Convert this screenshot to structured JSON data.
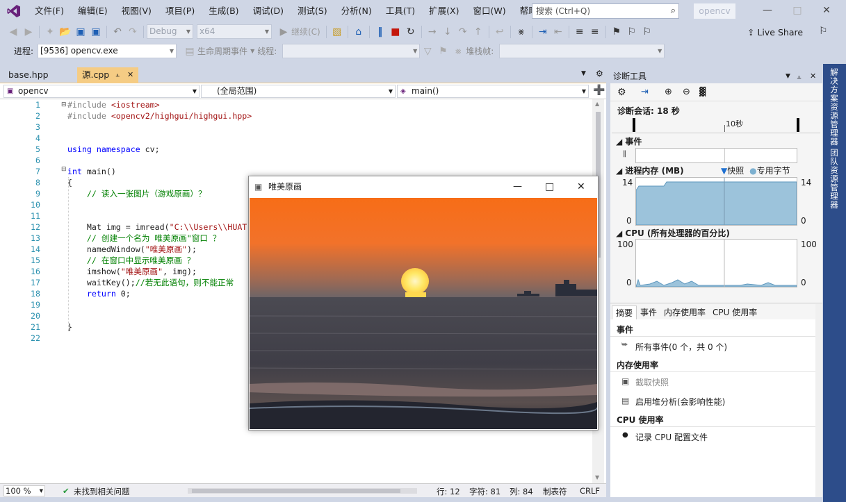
{
  "menu": [
    "文件(F)",
    "编辑(E)",
    "视图(V)",
    "项目(P)",
    "生成(B)",
    "调试(D)",
    "测试(S)",
    "分析(N)",
    "工具(T)",
    "扩展(X)",
    "窗口(W)",
    "帮助(H)"
  ],
  "search_placeholder": "搜索 (Ctrl+Q)",
  "solution_name": "opencv",
  "toolbar": {
    "config": "Debug",
    "platform": "x64",
    "continue_label": "继续(C)",
    "live_share": "Live Share"
  },
  "toolbar2": {
    "process_label": "进程:",
    "process_value": "[9536] opencv.exe",
    "lifecycle_label": "生命周期事件",
    "thread_label": "线程:",
    "stackframe_label": "堆栈帧:"
  },
  "tabs": [
    {
      "label": "base.hpp",
      "active": false
    },
    {
      "label": "源.cpp",
      "active": true
    }
  ],
  "editor_nav": {
    "project": "opencv",
    "scope": "(全局范围)",
    "member": "main()"
  },
  "code_lines": [
    {
      "n": "1",
      "html": "<span class='pp'>#include</span> <span class='inc'>&lt;iostream&gt;</span>"
    },
    {
      "n": "2",
      "html": "<span class='pp'>#include</span> <span class='inc'>&lt;opencv2/highgui/highgui.hpp&gt;</span>"
    },
    {
      "n": "3",
      "html": ""
    },
    {
      "n": "4",
      "html": ""
    },
    {
      "n": "5",
      "html": "<span class='kw'>using namespace</span> cv;"
    },
    {
      "n": "6",
      "html": ""
    },
    {
      "n": "7",
      "html": "<span class='kw'>int</span> main()"
    },
    {
      "n": "8",
      "html": "{"
    },
    {
      "n": "9",
      "html": "    <span class='cm'>// 读入一张图片（游戏原画）？</span>"
    },
    {
      "n": "10",
      "html": ""
    },
    {
      "n": "11",
      "html": ""
    },
    {
      "n": "12",
      "html": "    Mat img = imread(<span class='str'>\"C:\\\\Users\\\\HUAT</span>"
    },
    {
      "n": "13",
      "html": "    <span class='cm'>// 创建一个名为 唯美原画\"窗口 ？</span>"
    },
    {
      "n": "14",
      "html": "    namedWindow(<span class='str'>\"唯美原画\"</span>);"
    },
    {
      "n": "15",
      "html": "    <span class='cm'>// 在窗口中显示唯美原画 ？</span>"
    },
    {
      "n": "16",
      "html": "    imshow(<span class='str'>\"唯美原画\"</span>, img);"
    },
    {
      "n": "17",
      "html": "    waitKey();<span class='cm'>//若无此语句，则不能正常</span>"
    },
    {
      "n": "18",
      "html": "    <span class='kw'>return</span> 0;"
    },
    {
      "n": "19",
      "html": ""
    },
    {
      "n": "20",
      "html": ""
    },
    {
      "n": "21",
      "html": "}"
    },
    {
      "n": "22",
      "html": ""
    }
  ],
  "status": {
    "zoom": "100 %",
    "issues": "未找到相关问题",
    "line": "行: 12",
    "char": "字符: 81",
    "col": "列: 84",
    "tabs": "制表符",
    "eol": "CRLF"
  },
  "image_window": {
    "title": "唯美原画"
  },
  "diagnostics": {
    "title": "诊断工具",
    "session": "诊断会话: 18 秒",
    "timeline_label": "10秒",
    "events_title": "事件",
    "memory_title": "进程内存 (MB)",
    "legend_snapshot": "快照",
    "legend_private": "专用字节",
    "mem_max": "14",
    "mem_min": "0",
    "cpu_title": "CPU (所有处理器的百分比)",
    "cpu_max": "100",
    "cpu_min": "0",
    "subtabs": [
      "摘要",
      "事件",
      "内存使用率",
      "CPU 使用率"
    ],
    "sum_events_header": "事件",
    "all_events": "所有事件(0 个，共 0 个)",
    "mem_header": "内存使用率",
    "take_snapshot": "截取快照",
    "heap_profiling": "启用堆分析(会影响性能)",
    "cpu_header": "CPU 使用率",
    "record_cpu": "记录 CPU 配置文件"
  },
  "right_sidebar": [
    "解决方案资源管理器",
    "团队资源管理器"
  ]
}
